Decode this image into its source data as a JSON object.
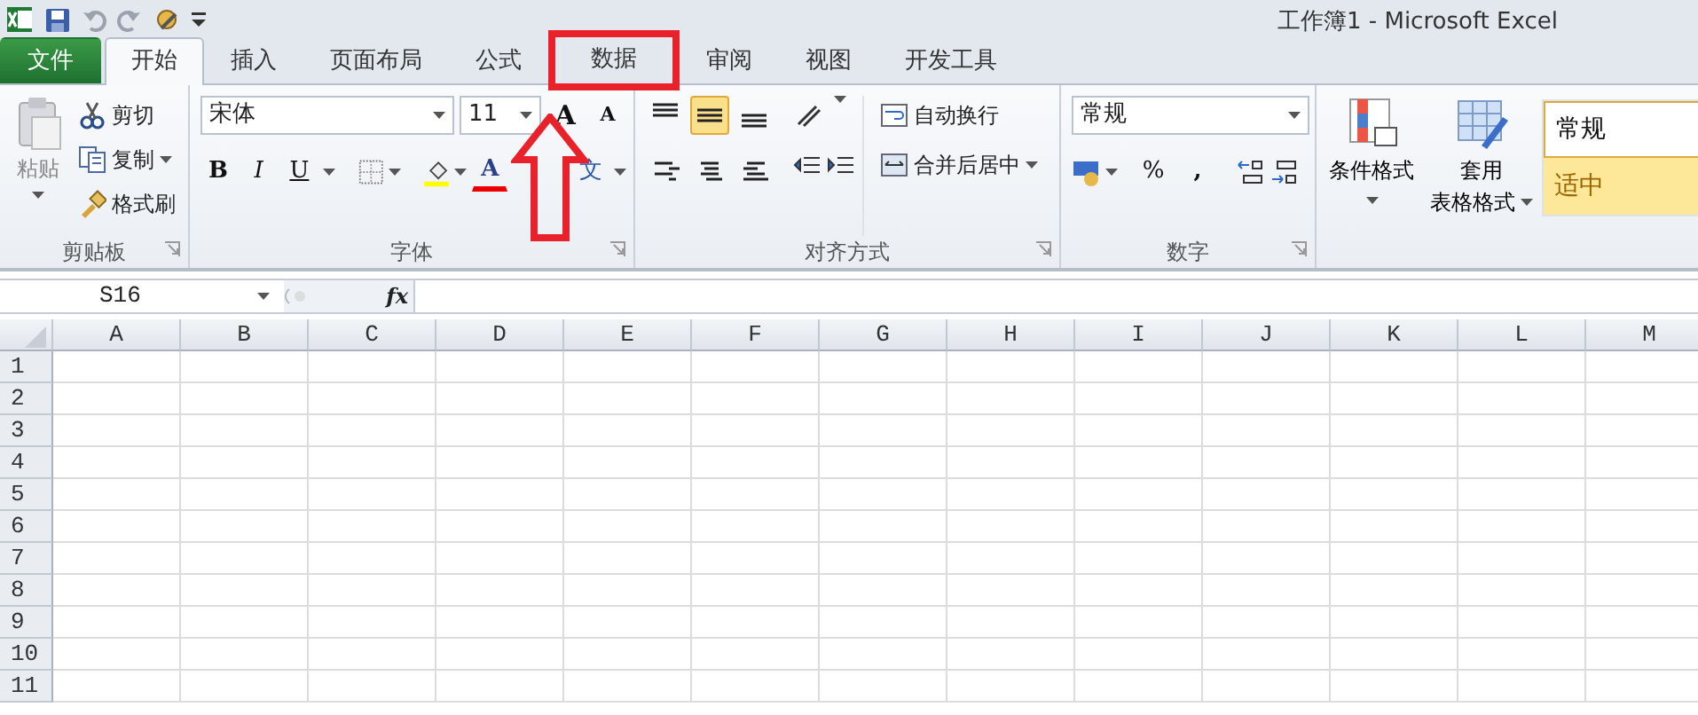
{
  "window": {
    "title": "工作簿1  -  Microsoft Excel"
  },
  "tabs": [
    {
      "label": "文件",
      "kind": "file",
      "selected": false,
      "highlighted": false
    },
    {
      "label": "开始",
      "kind": "tab",
      "selected": true,
      "highlighted": false
    },
    {
      "label": "插入",
      "kind": "tab",
      "selected": false,
      "highlighted": false
    },
    {
      "label": "页面布局",
      "kind": "tab",
      "selected": false,
      "highlighted": false
    },
    {
      "label": "公式",
      "kind": "tab",
      "selected": false,
      "highlighted": false
    },
    {
      "label": "数据",
      "kind": "tab",
      "selected": false,
      "highlighted": true
    },
    {
      "label": "审阅",
      "kind": "tab",
      "selected": false,
      "highlighted": false
    },
    {
      "label": "视图",
      "kind": "tab",
      "selected": false,
      "highlighted": false
    },
    {
      "label": "开发工具",
      "kind": "tab",
      "selected": false,
      "highlighted": false
    }
  ],
  "ribbon": {
    "clipboard": {
      "label": "剪贴板",
      "paste": "粘贴",
      "cut": "剪切",
      "copy": "复制",
      "format_painter": "格式刷"
    },
    "font": {
      "label": "字体",
      "font_name": "宋体",
      "font_size": "11",
      "grow": "A",
      "shrink": "A",
      "bold": "B",
      "italic": "I",
      "underline": "U",
      "font_color": "A",
      "phonetic": "文"
    },
    "alignment": {
      "label": "对齐方式",
      "wrap_text": "自动换行",
      "merge_center": "合并后居中",
      "middle_align_selected": true
    },
    "number": {
      "label": "数字",
      "format": "常规",
      "percent": "%",
      "comma": ","
    },
    "styles": {
      "conditional_format": "条件格式",
      "table_format": [
        "套用",
        "表格格式"
      ],
      "cell_styles": [
        {
          "label": "常规",
          "kind": "normal"
        },
        {
          "label": "适中",
          "kind": "neutral"
        }
      ]
    }
  },
  "formula_bar": {
    "name_box": "S16",
    "fx": "fx"
  },
  "sheet": {
    "columns": [
      "A",
      "B",
      "C",
      "D",
      "E",
      "F",
      "G",
      "H",
      "I",
      "J",
      "K",
      "L",
      "M"
    ],
    "rows": [
      "1",
      "2",
      "3",
      "4",
      "5",
      "6",
      "7",
      "8",
      "9",
      "10",
      "11"
    ]
  }
}
